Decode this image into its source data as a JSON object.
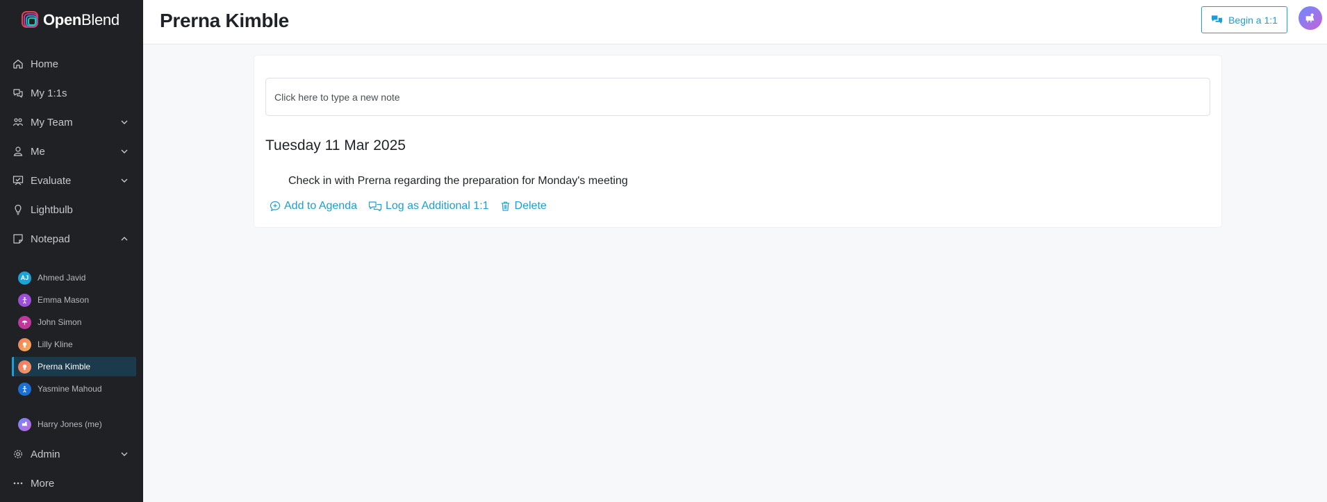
{
  "app": {
    "logo_bold": "Open",
    "logo_light": "Blend",
    "accent_color": "#1aa3d9",
    "sidebar_bg": "#1f2124"
  },
  "nav": {
    "home": {
      "label": "Home",
      "icon": "home-icon"
    },
    "my_1_1s": {
      "label": "My 1:1s",
      "icon": "chat-icon"
    },
    "my_team": {
      "label": "My Team",
      "icon": "team-icon"
    },
    "me": {
      "label": "Me",
      "icon": "user-icon"
    },
    "evaluate": {
      "label": "Evaluate",
      "icon": "evaluate-icon"
    },
    "lightbulb": {
      "label": "Lightbulb",
      "icon": "lightbulb-icon"
    },
    "notepad": {
      "label": "Notepad",
      "icon": "notepad-icon"
    },
    "admin": {
      "label": "Admin",
      "icon": "gear-icon"
    },
    "more": {
      "label": "More",
      "icon": "more-icon"
    }
  },
  "notepad_people": [
    {
      "name": "Ahmed Javid",
      "initials": "AJ",
      "color": "#1aa3d9"
    },
    {
      "name": "Emma Mason",
      "initials": "",
      "color": "#9b4fd6"
    },
    {
      "name": "John Simon",
      "initials": "",
      "color": "#c0399a"
    },
    {
      "name": "Lilly Kline",
      "initials": "",
      "color": "#f07a5a"
    },
    {
      "name": "Prerna Kimble",
      "initials": "",
      "color": "#f2735c"
    },
    {
      "name": "Yasmine Mahoud",
      "initials": "",
      "color": "#1a6fd4"
    }
  ],
  "me_person": {
    "name": "Harry Jones (me)",
    "color": "#8a7df0"
  },
  "header": {
    "title": "Prerna Kimble",
    "begin_label": "Begin a 1:1"
  },
  "note": {
    "placeholder": "Click here to type a new note",
    "date": "Tuesday 11 Mar 2025",
    "text": "Check in with Prerna regarding the preparation for Monday's meeting",
    "actions": {
      "add_to_agenda": "Add to Agenda",
      "log_additional": "Log as Additional 1:1",
      "delete": "Delete"
    }
  }
}
